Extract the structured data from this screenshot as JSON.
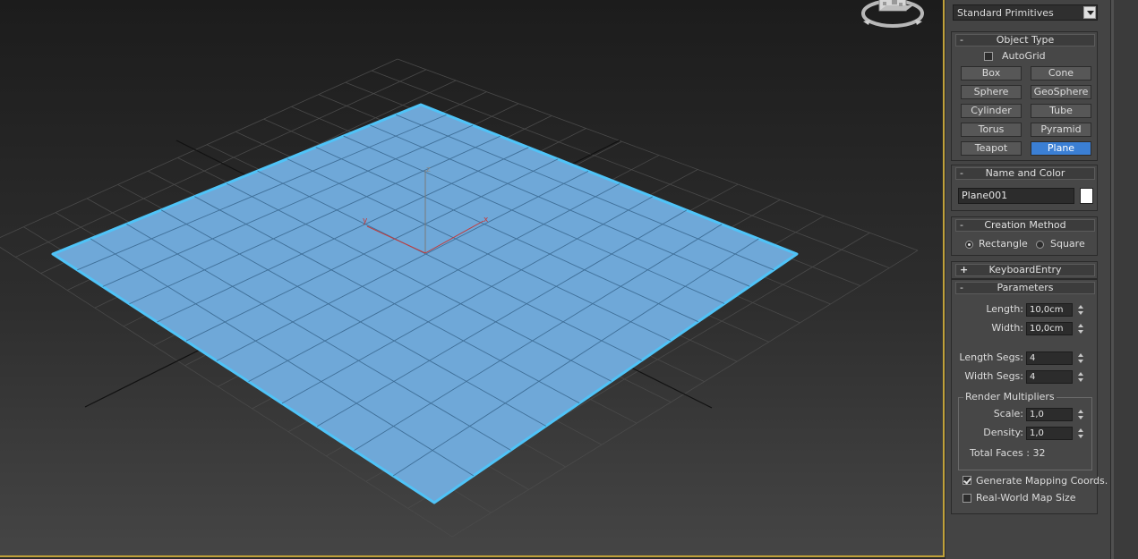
{
  "viewport": {
    "plane_color": "#6fa8d8",
    "edge_color": "#4fc3f7",
    "gizmo": {
      "x_label": "x",
      "y_label": "y",
      "z_label": "z"
    }
  },
  "dropdown": {
    "value": "Standard Primitives"
  },
  "object_type": {
    "title": "Object Type",
    "collapse_sign": "-",
    "autogrid_label": "AutoGrid",
    "buttons": [
      "Box",
      "Cone",
      "Sphere",
      "GeoSphere",
      "Cylinder",
      "Tube",
      "Torus",
      "Pyramid",
      "Teapot",
      "Plane"
    ],
    "active": "Plane"
  },
  "name_color": {
    "title": "Name and Color",
    "collapse_sign": "-",
    "name": "Plane001",
    "color": "#ffffff"
  },
  "creation_method": {
    "title": "Creation Method",
    "collapse_sign": "-",
    "rectangle": "Rectangle",
    "square": "Square"
  },
  "keyboard_entry": {
    "title": "KeyboardEntry",
    "expand_sign": "+"
  },
  "parameters": {
    "title": "Parameters",
    "collapse_sign": "-",
    "length_label": "Length:",
    "length": "10,0cm",
    "width_label": "Width:",
    "width": "10,0cm",
    "length_segs_label": "Length Segs:",
    "length_segs": "4",
    "width_segs_label": "Width Segs:",
    "width_segs": "4",
    "render_multipliers": "Render Multipliers",
    "scale_label": "Scale:",
    "scale": "1,0",
    "density_label": "Density:",
    "density": "1,0",
    "total_faces": "Total Faces : 32",
    "gen_mapping": "Generate Mapping Coords.",
    "real_world": "Real-World Map Size"
  }
}
